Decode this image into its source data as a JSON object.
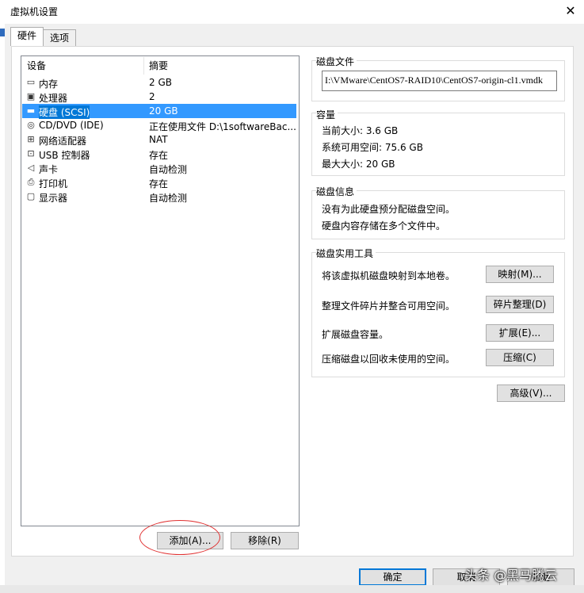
{
  "window": {
    "title": "虚拟机设置",
    "close_glyph": "✕"
  },
  "tabs": [
    {
      "label": "硬件"
    },
    {
      "label": "选项"
    }
  ],
  "device_list": {
    "col_device": "设备",
    "col_summary": "摘要",
    "items": [
      {
        "icon": "▭",
        "name": "内存",
        "summary": "2 GB"
      },
      {
        "icon": "▣",
        "name": "处理器",
        "summary": "2"
      },
      {
        "icon": "▬",
        "name": "硬盘 (SCSI)",
        "summary": "20 GB"
      },
      {
        "icon": "◎",
        "name": "CD/DVD (IDE)",
        "summary": "正在使用文件 D:\\1softwareBac..."
      },
      {
        "icon": "⊞",
        "name": "网络适配器",
        "summary": "NAT"
      },
      {
        "icon": "⊡",
        "name": "USB 控制器",
        "summary": "存在"
      },
      {
        "icon": "◁",
        "name": "声卡",
        "summary": "自动检测"
      },
      {
        "icon": "⎙",
        "name": "打印机",
        "summary": "存在"
      },
      {
        "icon": "▢",
        "name": "显示器",
        "summary": "自动检测"
      }
    ],
    "selected_index": 2
  },
  "buttons": {
    "add": "添加(A)...",
    "remove": "移除(R)",
    "ok": "确定",
    "cancel": "取消",
    "help": "帮助",
    "advanced": "高级(V)..."
  },
  "disk_file": {
    "title": "磁盘文件",
    "path": "I:\\VMware\\CentOS7-RAID10\\CentOS7-origin-cl1.vmdk"
  },
  "capacity": {
    "title": "容量",
    "current_size": "当前大小: 3.6 GB",
    "system_free": "系统可用空间: 75.6 GB",
    "max_size": "最大大小: 20 GB"
  },
  "disk_info": {
    "title": "磁盘信息",
    "line1": "没有为此硬盘预分配磁盘空间。",
    "line2": "硬盘内容存储在多个文件中。"
  },
  "disk_utilities": {
    "title": "磁盘实用工具",
    "map_desc": "将该虚拟机磁盘映射到本地卷。",
    "map_btn": "映射(M)...",
    "defrag_desc": "整理文件碎片并整合可用空间。",
    "defrag_btn": "碎片整理(D)",
    "expand_desc": "扩展磁盘容量。",
    "expand_btn": "扩展(E)...",
    "compact_desc": "压缩磁盘以回收未使用的空间。",
    "compact_btn": "压缩(C)"
  },
  "watermark": "头条 @黑马腾云"
}
